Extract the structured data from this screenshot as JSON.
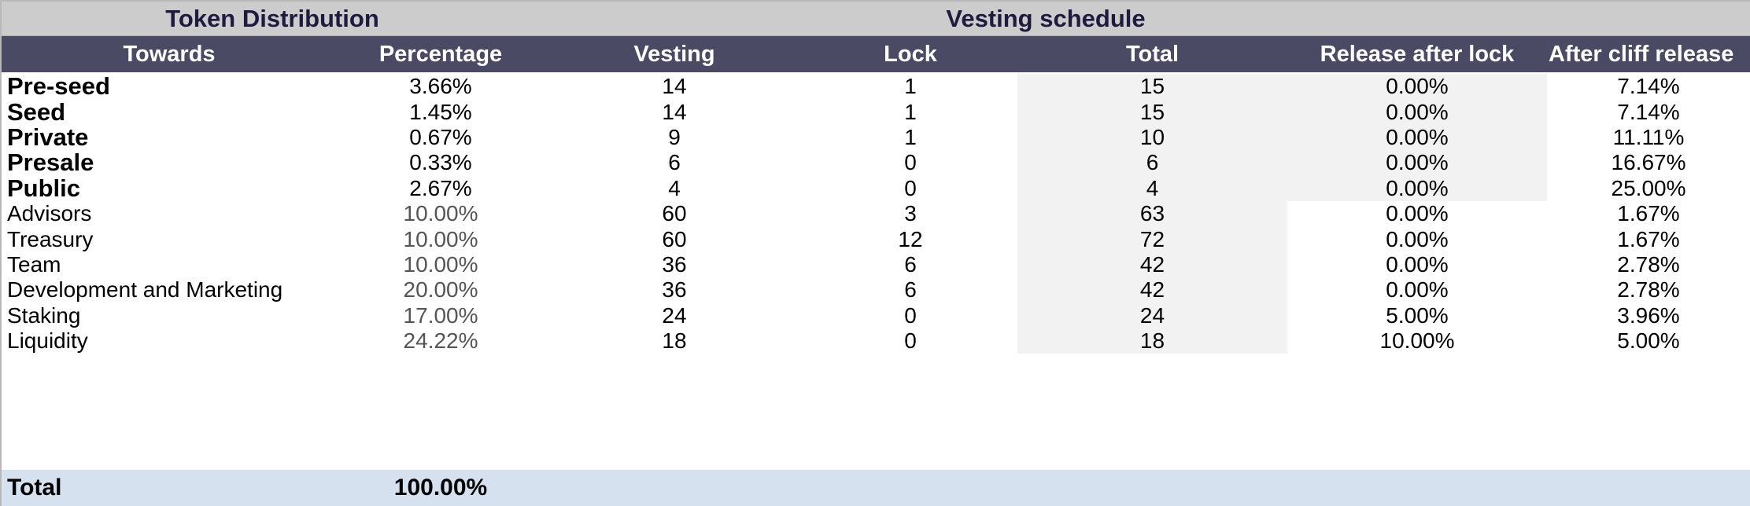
{
  "titles": {
    "token_distribution": "Token Distribution",
    "vesting_schedule": "Vesting schedule"
  },
  "headers": {
    "towards": "Towards",
    "percentage": "Percentage",
    "vesting": "Vesting",
    "lock": "Lock",
    "total": "Total",
    "release_after_lock": "Release after lock",
    "after_cliff_release": "After cliff release"
  },
  "rows": [
    {
      "name": "Pre-seed",
      "bold": true,
      "percentage": "3.66%",
      "vesting": "14",
      "lock": "1",
      "total": "15",
      "release_after_lock": "0.00%",
      "after_cliff_release": "7.14%"
    },
    {
      "name": "Seed",
      "bold": true,
      "percentage": "1.45%",
      "vesting": "14",
      "lock": "1",
      "total": "15",
      "release_after_lock": "0.00%",
      "after_cliff_release": "7.14%"
    },
    {
      "name": "Private",
      "bold": true,
      "percentage": "0.67%",
      "vesting": "9",
      "lock": "1",
      "total": "10",
      "release_after_lock": "0.00%",
      "after_cliff_release": "11.11%"
    },
    {
      "name": "Presale",
      "bold": true,
      "percentage": "0.33%",
      "vesting": "6",
      "lock": "0",
      "total": "6",
      "release_after_lock": "0.00%",
      "after_cliff_release": "16.67%"
    },
    {
      "name": "Public",
      "bold": true,
      "percentage": "2.67%",
      "vesting": "4",
      "lock": "0",
      "total": "4",
      "release_after_lock": "0.00%",
      "after_cliff_release": "25.00%"
    },
    {
      "name": "Advisors",
      "bold": false,
      "percentage": "10.00%",
      "vesting": "60",
      "lock": "3",
      "total": "63",
      "release_after_lock": "0.00%",
      "after_cliff_release": "1.67%"
    },
    {
      "name": "Treasury",
      "bold": false,
      "percentage": "10.00%",
      "vesting": "60",
      "lock": "12",
      "total": "72",
      "release_after_lock": "0.00%",
      "after_cliff_release": "1.67%"
    },
    {
      "name": "Team",
      "bold": false,
      "percentage": "10.00%",
      "vesting": "36",
      "lock": "6",
      "total": "42",
      "release_after_lock": "0.00%",
      "after_cliff_release": "2.78%"
    },
    {
      "name": "Development and Marketing",
      "bold": false,
      "percentage": "20.00%",
      "vesting": "36",
      "lock": "6",
      "total": "42",
      "release_after_lock": "0.00%",
      "after_cliff_release": "2.78%"
    },
    {
      "name": "Staking",
      "bold": false,
      "percentage": "17.00%",
      "vesting": "24",
      "lock": "0",
      "total": "24",
      "release_after_lock": "5.00%",
      "after_cliff_release": "3.96%"
    },
    {
      "name": "Liquidity",
      "bold": false,
      "percentage": "24.22%",
      "vesting": "18",
      "lock": "0",
      "total": "18",
      "release_after_lock": "10.00%",
      "after_cliff_release": "5.00%"
    }
  ],
  "total_row": {
    "label": "Total",
    "percentage": "100.00%"
  },
  "colors": {
    "title_bar": "#cccccc",
    "title_text": "#1e1b3f",
    "header_bar": "#4b4a65",
    "header_text": "#ffffff",
    "shaded_cell": "#f2f2f2",
    "total_row": "#d5e1ef"
  }
}
